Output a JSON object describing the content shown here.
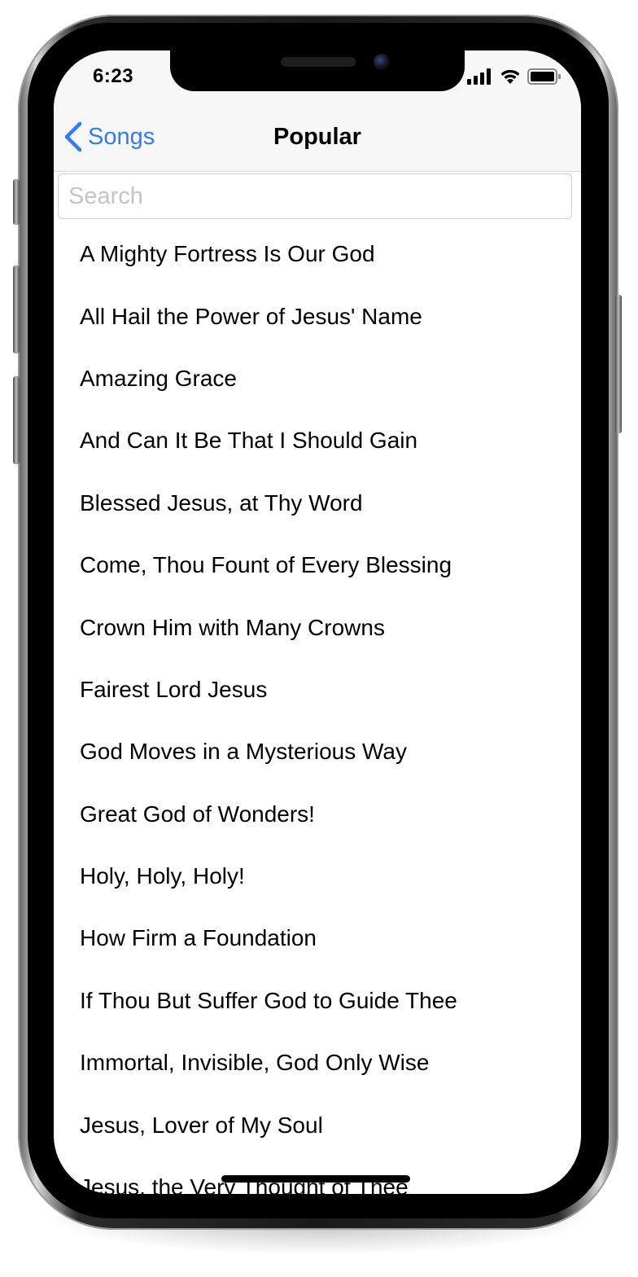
{
  "status_bar": {
    "time": "6:23",
    "icons": [
      "cellular-signal-icon",
      "wifi-icon",
      "battery-icon"
    ]
  },
  "nav": {
    "back_label": "Songs",
    "title": "Popular"
  },
  "search": {
    "placeholder": "Search",
    "value": ""
  },
  "songs": [
    "A Mighty Fortress Is Our God",
    "All Hail the Power of Jesus' Name",
    "Amazing Grace",
    "And Can It Be That I Should Gain",
    "Blessed Jesus, at Thy Word",
    "Come, Thou Fount of Every Blessing",
    "Crown Him with Many Crowns",
    "Fairest Lord Jesus",
    "God Moves in a Mysterious Way",
    "Great God of Wonders!",
    "Holy, Holy, Holy!",
    "How Firm a Foundation",
    "If Thou But Suffer God to Guide Thee",
    "Immortal, Invisible, God Only Wise",
    "Jesus, Lover of My Soul",
    "Jesus, the Very Thought of Thee"
  ],
  "colors": {
    "accent": "#2f7cf6",
    "nav_background": "#f7f7f7",
    "text": "#000000",
    "placeholder": "#c4c4c4"
  }
}
